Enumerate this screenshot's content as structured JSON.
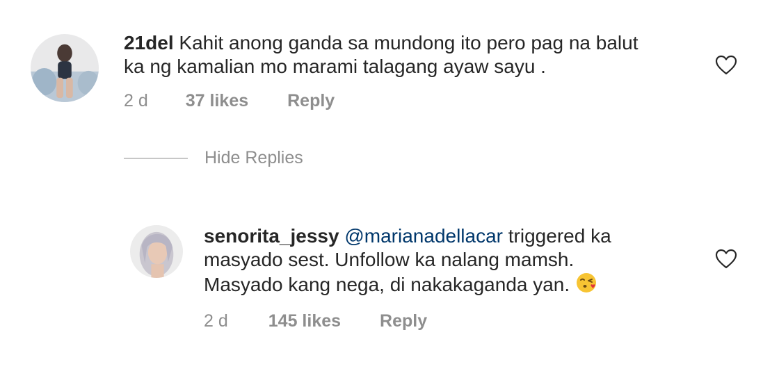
{
  "comments": [
    {
      "username": "21del",
      "text_line1": "Kahit anong ganda sa mundong ito pero pag na balut",
      "text_line2": "ka ng kamalian mo marami talagang ayaw sayu .",
      "time": "2 d",
      "likes": "37 likes",
      "reply": "Reply",
      "avatar_icon": "profile-photo",
      "heart_icon": "heart-outline-icon"
    }
  ],
  "hide_replies": "Hide Replies",
  "replies": [
    {
      "username": "senorita_jessy",
      "mention": "@marianadellacar",
      "text_line1_rest": "triggered ka",
      "text_line2": "masyado sest. Unfollow ka nalang mamsh.",
      "text_line3": "Masyado kang nega, di nakakaganda yan.",
      "emoji_icon": "face-blowing-kiss-emoji",
      "time": "2 d",
      "likes": "145 likes",
      "reply": "Reply",
      "avatar_icon": "profile-photo",
      "heart_icon": "heart-outline-icon"
    }
  ],
  "colors": {
    "text": "#262626",
    "meta": "#8e8e8e",
    "mention": "#00376b",
    "divider": "#c7c7c7"
  }
}
